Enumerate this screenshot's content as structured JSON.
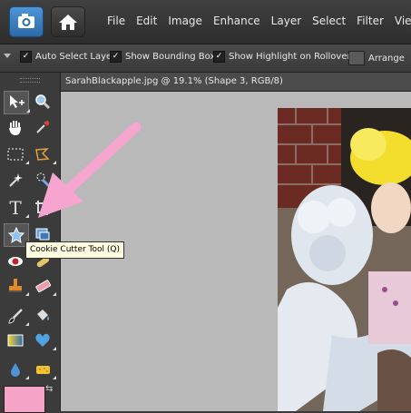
{
  "menubar": {
    "items": [
      "File",
      "Edit",
      "Image",
      "Enhance",
      "Layer",
      "Select",
      "Filter",
      "View"
    ],
    "buttons": [
      "camera-icon",
      "home-icon"
    ]
  },
  "options_bar": {
    "auto_select_layer": "Auto Select Layer",
    "show_bounding_box": "Show Bounding Box",
    "show_highlight": "Show Highlight on Rollover",
    "arrange": "Arrange"
  },
  "document": {
    "tab_title": "SarahBlackapple.jpg @ 19.1% (Shape 3, RGB/8)"
  },
  "toolbox": {
    "tools": [
      "move-tool-icon",
      "zoom-tool-icon",
      "hand-tool-icon",
      "eyedropper-tool-icon",
      "marquee-tool-icon",
      "lasso-tool-icon",
      "magic-wand-tool-icon",
      "quick-selection-tool-icon",
      "type-tool-icon",
      "crop-tool-icon",
      "cookie-cutter-tool-icon",
      "recompose-tool-icon",
      "red-eye-tool-icon",
      "spot-healing-tool-icon",
      "clone-stamp-tool-icon",
      "eraser-tool-icon",
      "brush-tool-icon",
      "paint-bucket-tool-icon",
      "gradient-tool-icon",
      "custom-shape-tool-icon",
      "blur-tool-icon",
      "sponge-tool-icon"
    ],
    "foreground_color": "#f5a3c7"
  },
  "tooltip": {
    "text": "Cookie Cutter Tool (Q)"
  },
  "colors": {
    "annotation_arrow": "#f6a5cf",
    "canvas_bg": "#b9b9b9",
    "ui_dark": "#3b3b3b"
  }
}
